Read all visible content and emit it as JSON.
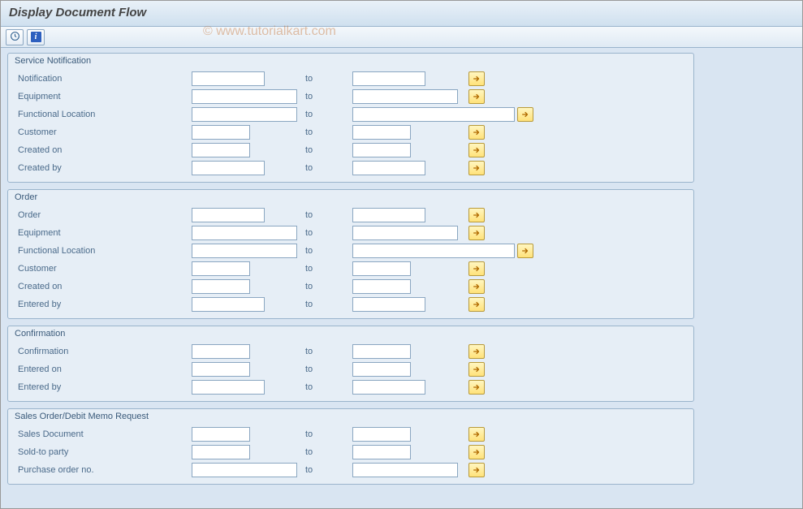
{
  "title": "Display Document Flow",
  "watermark": "© www.tutorialkart.com",
  "to_label": "to",
  "groups": [
    {
      "title": "Service Notification",
      "rows": [
        {
          "label": "Notification",
          "fw": 90,
          "tw": 90
        },
        {
          "label": "Equipment",
          "fw": 130,
          "tw": 130
        },
        {
          "label": "Functional Location",
          "fw": 130,
          "tw": 200
        },
        {
          "label": "Customer",
          "fw": 72,
          "tw": 72
        },
        {
          "label": "Created on",
          "fw": 72,
          "tw": 72
        },
        {
          "label": "Created by",
          "fw": 90,
          "tw": 90
        }
      ]
    },
    {
      "title": "Order",
      "rows": [
        {
          "label": "Order",
          "fw": 90,
          "tw": 90
        },
        {
          "label": "Equipment",
          "fw": 130,
          "tw": 130
        },
        {
          "label": "Functional Location",
          "fw": 130,
          "tw": 200
        },
        {
          "label": "Customer",
          "fw": 72,
          "tw": 72
        },
        {
          "label": "Created on",
          "fw": 72,
          "tw": 72
        },
        {
          "label": "Entered by",
          "fw": 90,
          "tw": 90
        }
      ]
    },
    {
      "title": "Confirmation",
      "rows": [
        {
          "label": "Confirmation",
          "fw": 72,
          "tw": 72
        },
        {
          "label": "Entered on",
          "fw": 72,
          "tw": 72
        },
        {
          "label": "Entered by",
          "fw": 90,
          "tw": 90
        }
      ]
    },
    {
      "title": "Sales Order/Debit Memo Request",
      "rows": [
        {
          "label": "Sales Document",
          "fw": 72,
          "tw": 72
        },
        {
          "label": "Sold-to party",
          "fw": 72,
          "tw": 72
        },
        {
          "label": "Purchase order no.",
          "fw": 130,
          "tw": 130
        }
      ]
    }
  ]
}
